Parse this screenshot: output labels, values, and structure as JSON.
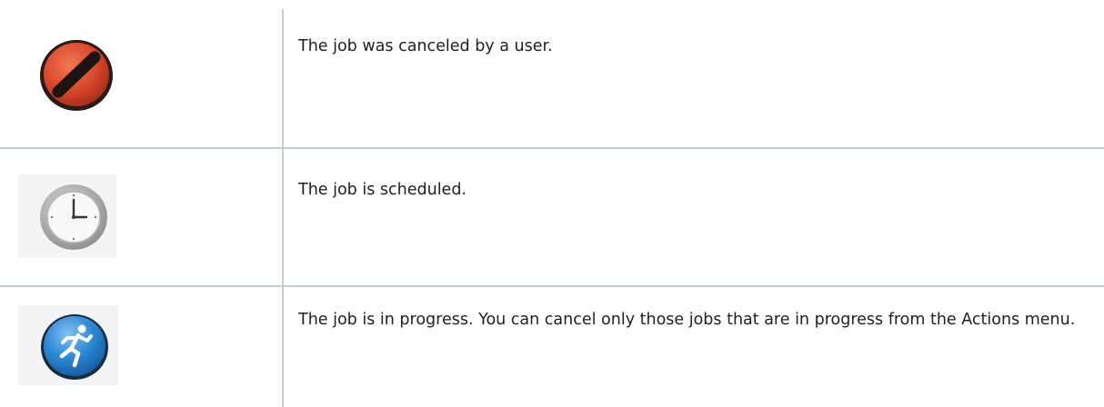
{
  "rows": [
    {
      "icon": "canceled-icon",
      "description": "The job was canceled by a user."
    },
    {
      "icon": "clock-icon",
      "description": "The job is scheduled."
    },
    {
      "icon": "running-person-icon",
      "description": "The job is in progress. You can cancel only those jobs that are in progress from the Actions menu."
    }
  ],
  "colors": {
    "canceled_red": "#d9462a",
    "scheduled_gray": "#a9a9a9",
    "in_progress_blue": "#2b86d3",
    "divider": "#c3cdd7"
  }
}
